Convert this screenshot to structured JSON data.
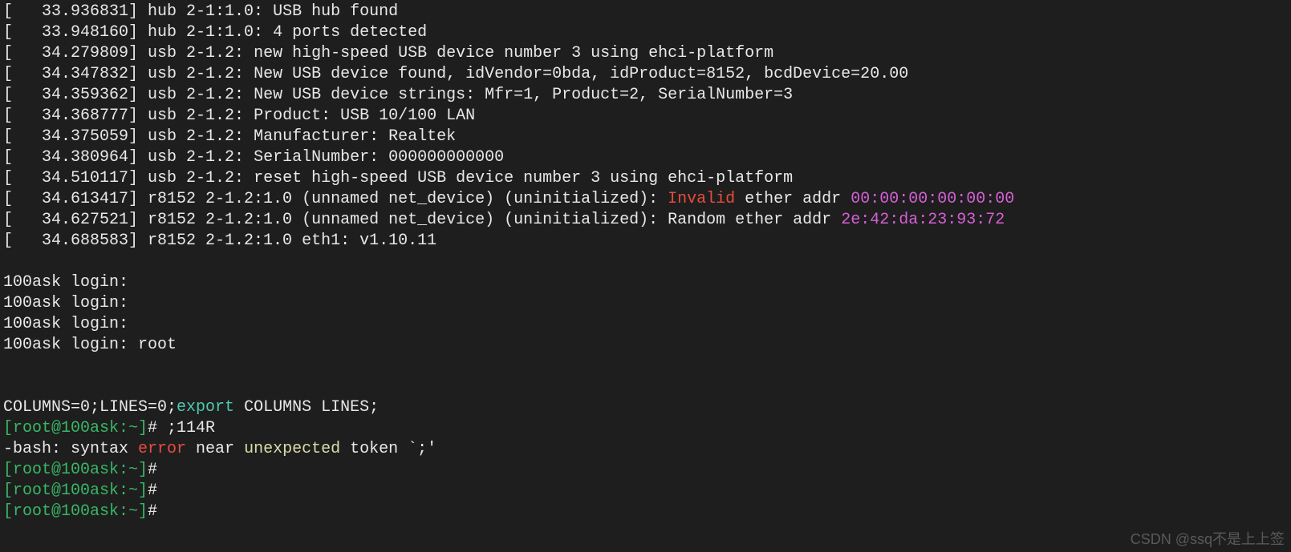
{
  "dmesg": [
    {
      "ts": "33.936831",
      "dev": "hub 2-1:1.0",
      "msg": "USB hub found"
    },
    {
      "ts": "33.948160",
      "dev": "hub 2-1:1.0",
      "msg": "4 ports detected"
    },
    {
      "ts": "34.279809",
      "dev": "usb 2-1.2",
      "msg": "new high-speed USB device number 3 using ehci-platform"
    },
    {
      "ts": "34.347832",
      "dev": "usb 2-1.2",
      "msg": "New USB device found, idVendor=0bda, idProduct=8152, bcdDevice=20.00"
    },
    {
      "ts": "34.359362",
      "dev": "usb 2-1.2",
      "msg": "New USB device strings: Mfr=1, Product=2, SerialNumber=3"
    },
    {
      "ts": "34.368777",
      "dev": "usb 2-1.2",
      "msg": "Product: USB 10/100 LAN"
    },
    {
      "ts": "34.375059",
      "dev": "usb 2-1.2",
      "msg": "Manufacturer: Realtek"
    },
    {
      "ts": "34.380964",
      "dev": "usb 2-1.2",
      "msg": "SerialNumber: 000000000000"
    },
    {
      "ts": "34.510117",
      "dev": "usb 2-1.2",
      "msg": "reset high-speed USB device number 3 using ehci-platform"
    },
    {
      "ts": "34.613417",
      "dev": "r8152 2-1.2:1.0 (unnamed net_device) (uninitialized)",
      "msg_pre": "",
      "highlight": "Invalid",
      "hl_class": "fg-red",
      "msg_post": " ether addr ",
      "mac": "00:00:00:00:00:00"
    },
    {
      "ts": "34.627521",
      "dev": "r8152 2-1.2:1.0 (unnamed net_device) (uninitialized)",
      "msg": "Random ether addr ",
      "mac": "2e:42:da:23:93:72"
    },
    {
      "ts": "34.688583",
      "dev": "r8152 2-1.2:1.0 eth1",
      "msg": "v1.10.11"
    }
  ],
  "login_prompts": [
    "100ask login: ",
    "100ask login: ",
    "100ask login: ",
    "100ask login: root"
  ],
  "env_line": {
    "pre": "COLUMNS=0;LINES=0;",
    "kw": "export",
    "post": " COLUMNS LINES;"
  },
  "prompt": {
    "user_host": "[root@100ask:~]",
    "hash": "#"
  },
  "first_cmd": " ;114R",
  "bash_error": {
    "pre": "-bash: syntax ",
    "err": "error",
    "mid": " near ",
    "unexp": "unexpected",
    "post": " token `;'"
  },
  "empty_prompt_count": 3,
  "watermark": "CSDN @ssq不是上上签",
  "colors": {
    "bg": "#1e1e1e",
    "fg": "#d4d4d4",
    "green": "#38b764",
    "red": "#e84c3d",
    "magenta": "#d65fd6",
    "cyan": "#4ec9b0",
    "yellow": "#dcdcaa"
  }
}
